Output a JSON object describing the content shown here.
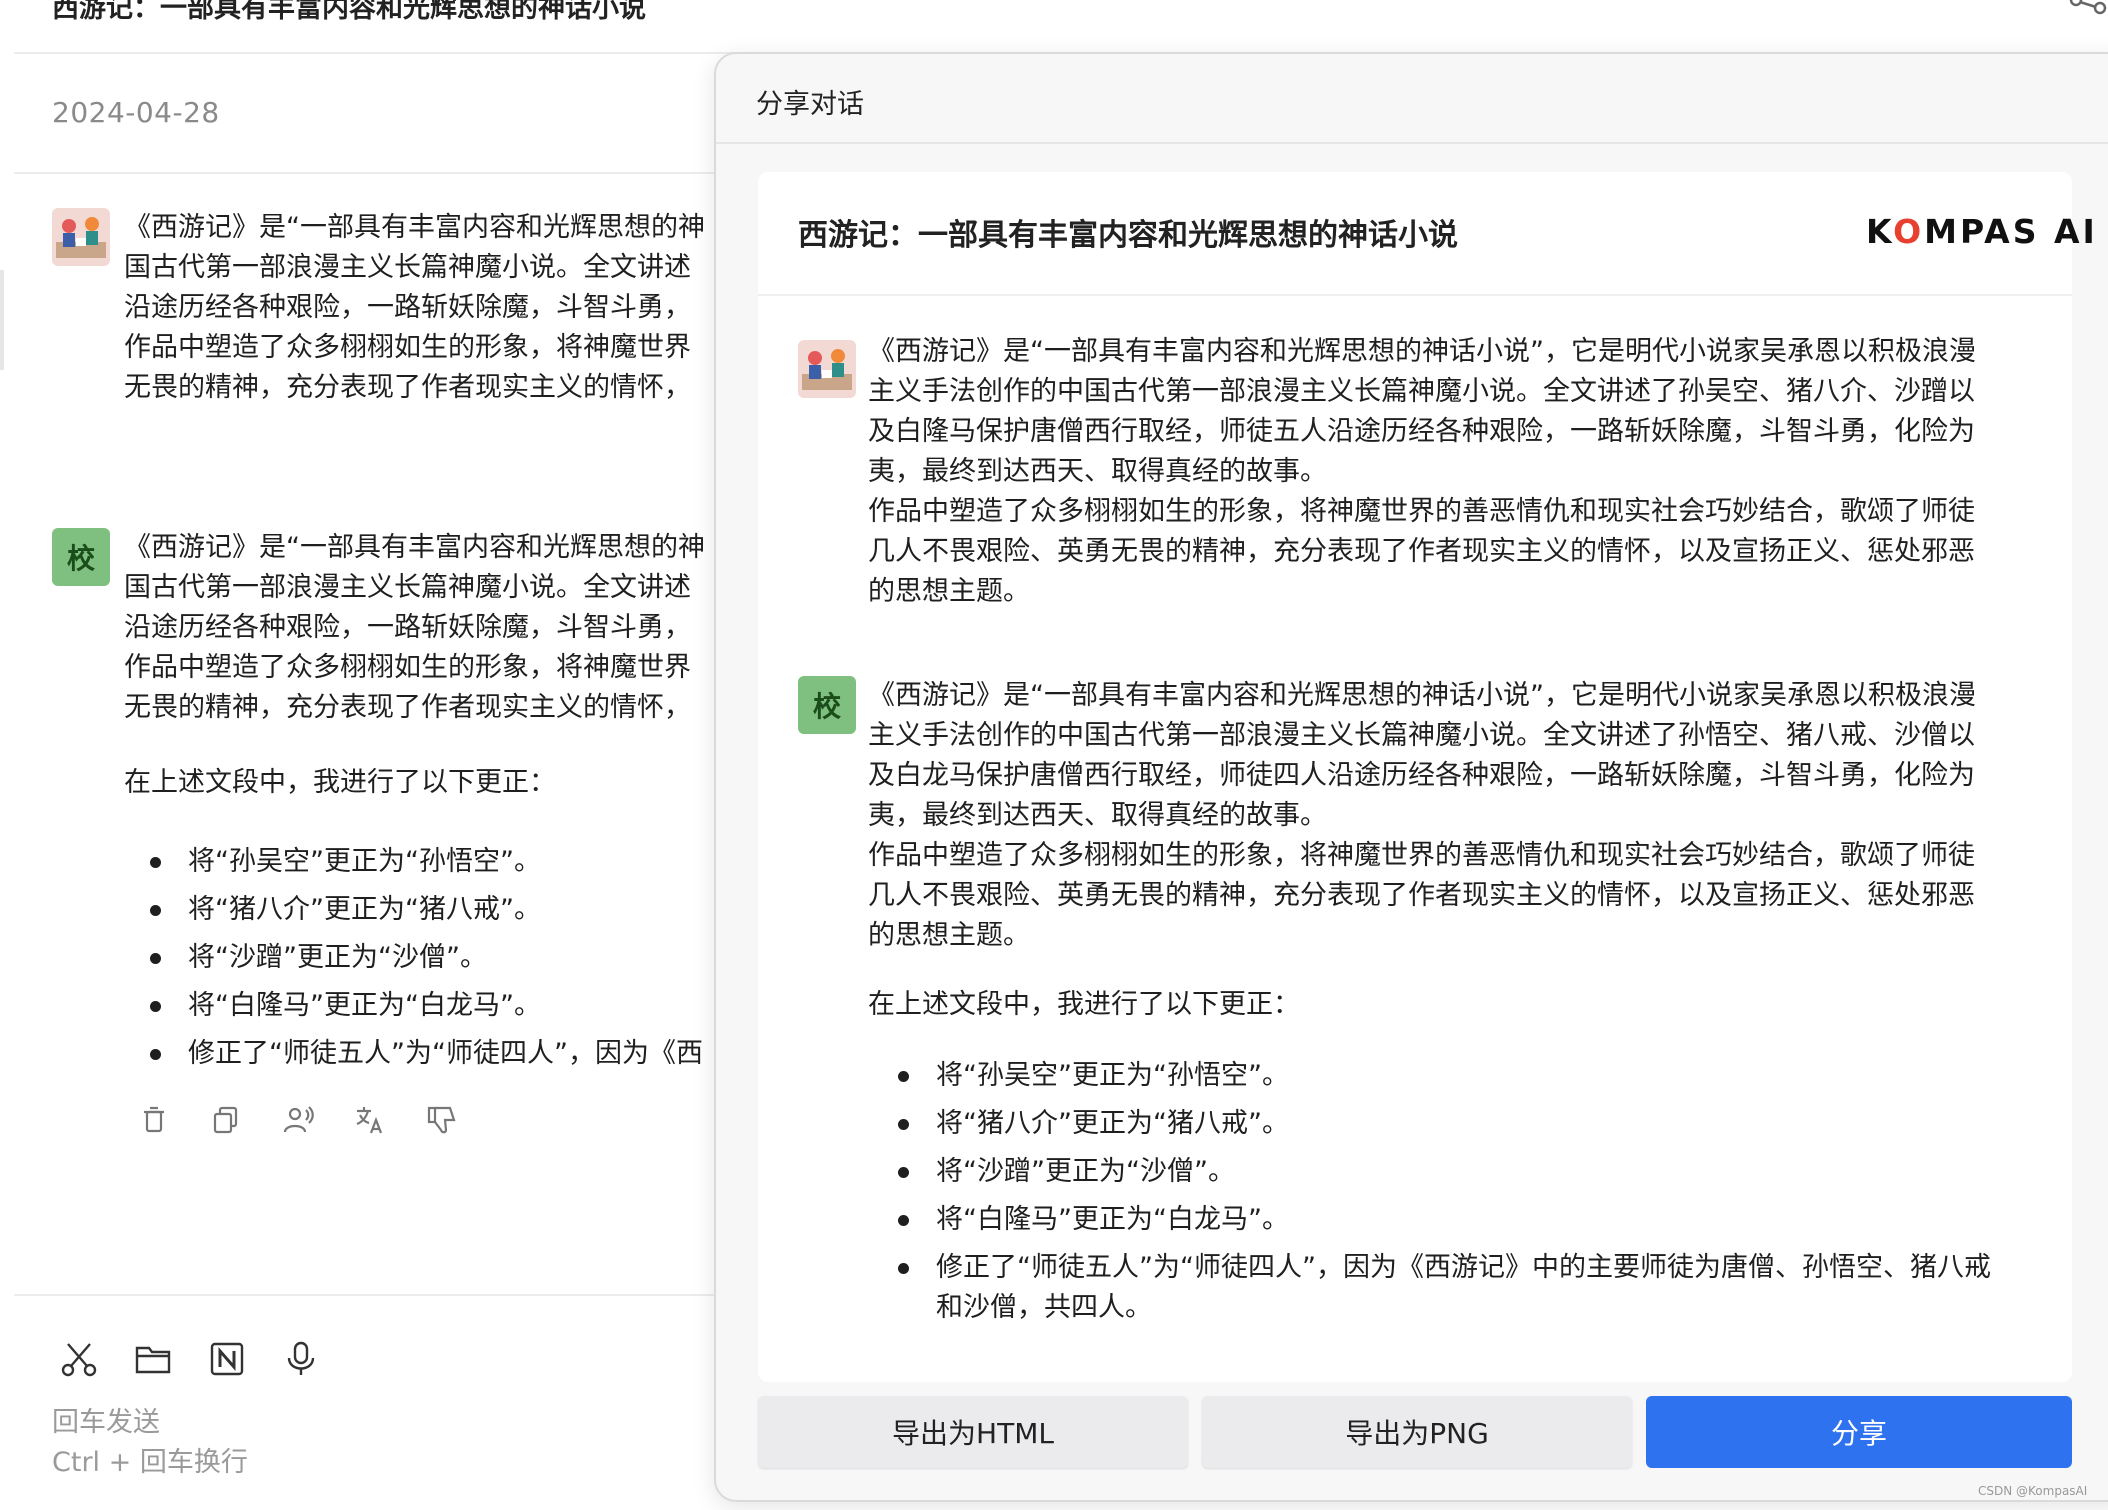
{
  "conversation": {
    "title": "西游记：一部具有丰富内容和光辉思想的神话小说",
    "date": "2024-04-28",
    "corrector_avatar_label": "校",
    "original_lines_truncated": [
      "《西游记》是“一部具有丰富内容和光辉思想的神",
      "国古代第一部浪漫主义长篇神魔小说。全文讲述",
      "沿途历经各种艰险，一路斩妖除魔，斗智斗勇，",
      "作品中塑造了众多栩栩如生的形象，将神魔世界",
      "无畏的精神，充分表现了作者现实主义的情怀，"
    ],
    "corrected_lines_truncated": [
      "《西游记》是“一部具有丰富内容和光辉思想的神",
      "国古代第一部浪漫主义长篇神魔小说。全文讲述",
      "沿途历经各种艰险，一路斩妖除魔，斗智斗勇，",
      "作品中塑造了众多栩栩如生的形象，将神魔世界",
      "无畏的精神，充分表现了作者现实主义的情怀，"
    ],
    "corrections_intro": "在上述文段中，我进行了以下更正：",
    "corrections_truncated": [
      "将“孙吴空”更正为“孙悟空”。",
      "将“猪八介”更正为“猪八戒”。",
      "将“沙蹭”更正为“沙僧”。",
      "将“白隆马”更正为“白龙马”。",
      "修正了“师徒五人”为“师徒四人”，因为《西"
    ],
    "action_icons": [
      "trash-icon",
      "copy-icon",
      "voice-user-icon",
      "translate-icon",
      "thumbs-down-icon"
    ]
  },
  "input_area": {
    "tool_icons": [
      "scissors-icon",
      "folder-icon",
      "notion-icon",
      "microphone-icon"
    ],
    "hint_send": "回车发送",
    "hint_newline": "Ctrl + 回车换行"
  },
  "share_modal": {
    "header": "分享对话",
    "card_title": "西游记：一部具有丰富内容和光辉思想的神话小说",
    "brand": {
      "before": "K",
      "accent": "O",
      "after": "MPAS AI",
      "accent_color": "#e8402f"
    },
    "original_lines": [
      "《西游记》是“一部具有丰富内容和光辉思想的神话小说”，它是明代小说家吴承恩以积极浪漫",
      "主义手法创作的中国古代第一部浪漫主义长篇神魔小说。全文讲述了孙吴空、猪八介、沙蹭以",
      "及白隆马保护唐僧西行取经，师徒五人沿途历经各种艰险，一路斩妖除魔，斗智斗勇，化险为",
      "夷，最终到达西天、取得真经的故事。",
      "作品中塑造了众多栩栩如生的形象，将神魔世界的善恶情仇和现实社会巧妙结合，歌颂了师徒",
      "几人不畏艰险、英勇无畏的精神，充分表现了作者现实主义的情怀，以及宣扬正义、惩处邪恶",
      "的思想主题。"
    ],
    "corrector_avatar_label": "校",
    "corrected_lines": [
      "《西游记》是“一部具有丰富内容和光辉思想的神话小说”，它是明代小说家吴承恩以积极浪漫",
      "主义手法创作的中国古代第一部浪漫主义长篇神魔小说。全文讲述了孙悟空、猪八戒、沙僧以",
      "及白龙马保护唐僧西行取经，师徒四人沿途历经各种艰险，一路斩妖除魔，斗智斗勇，化险为",
      "夷，最终到达西天、取得真经的故事。",
      "作品中塑造了众多栩栩如生的形象，将神魔世界的善恶情仇和现实社会巧妙结合，歌颂了师徒",
      "几人不畏艰险、英勇无畏的精神，充分表现了作者现实主义的情怀，以及宣扬正义、惩处邪恶",
      "的思想主题。"
    ],
    "corrections_intro": "在上述文段中，我进行了以下更正：",
    "corrections": [
      [
        "将“孙吴空”更正为“孙悟空”。"
      ],
      [
        "将“猪八介”更正为“猪八戒”。"
      ],
      [
        "将“沙蹭”更正为“沙僧”。"
      ],
      [
        "将“白隆马”更正为“白龙马”。"
      ],
      [
        "修正了“师徒五人”为“师徒四人”，因为《西游记》中的主要师徒为唐僧、孙悟空、猪八戒",
        "和沙僧，共四人。"
      ]
    ],
    "buttons": {
      "export_html": "导出为HTML",
      "export_png": "导出为PNG",
      "share": "分享"
    }
  },
  "watermark": "CSDN @KompasAI",
  "colors": {
    "share_button": "#2f72f0",
    "corrector_avatar": "#7fbf7f",
    "brand_accent": "#e8402f"
  }
}
